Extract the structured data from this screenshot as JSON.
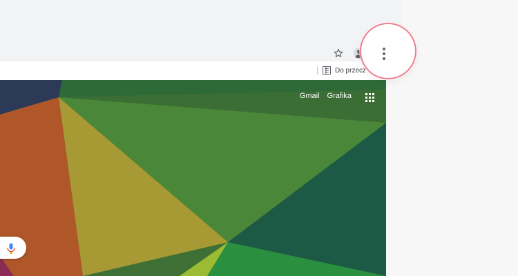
{
  "bookmarks_bar": {
    "reading_list_label": "Do przeczy"
  },
  "toolbar": {
    "icons": [
      "star-icon",
      "avatar-icon",
      "kebab-menu-icon"
    ]
  },
  "new_tab_page": {
    "links": [
      {
        "label": "Gmail"
      },
      {
        "label": "Grafika"
      }
    ],
    "icons": [
      "apps-grid-icon",
      "mic-icon"
    ]
  },
  "colors": {
    "highlight_ring": "#ef7d8f",
    "link_text": "#ffffff",
    "icon_gray": "#5f6368"
  }
}
